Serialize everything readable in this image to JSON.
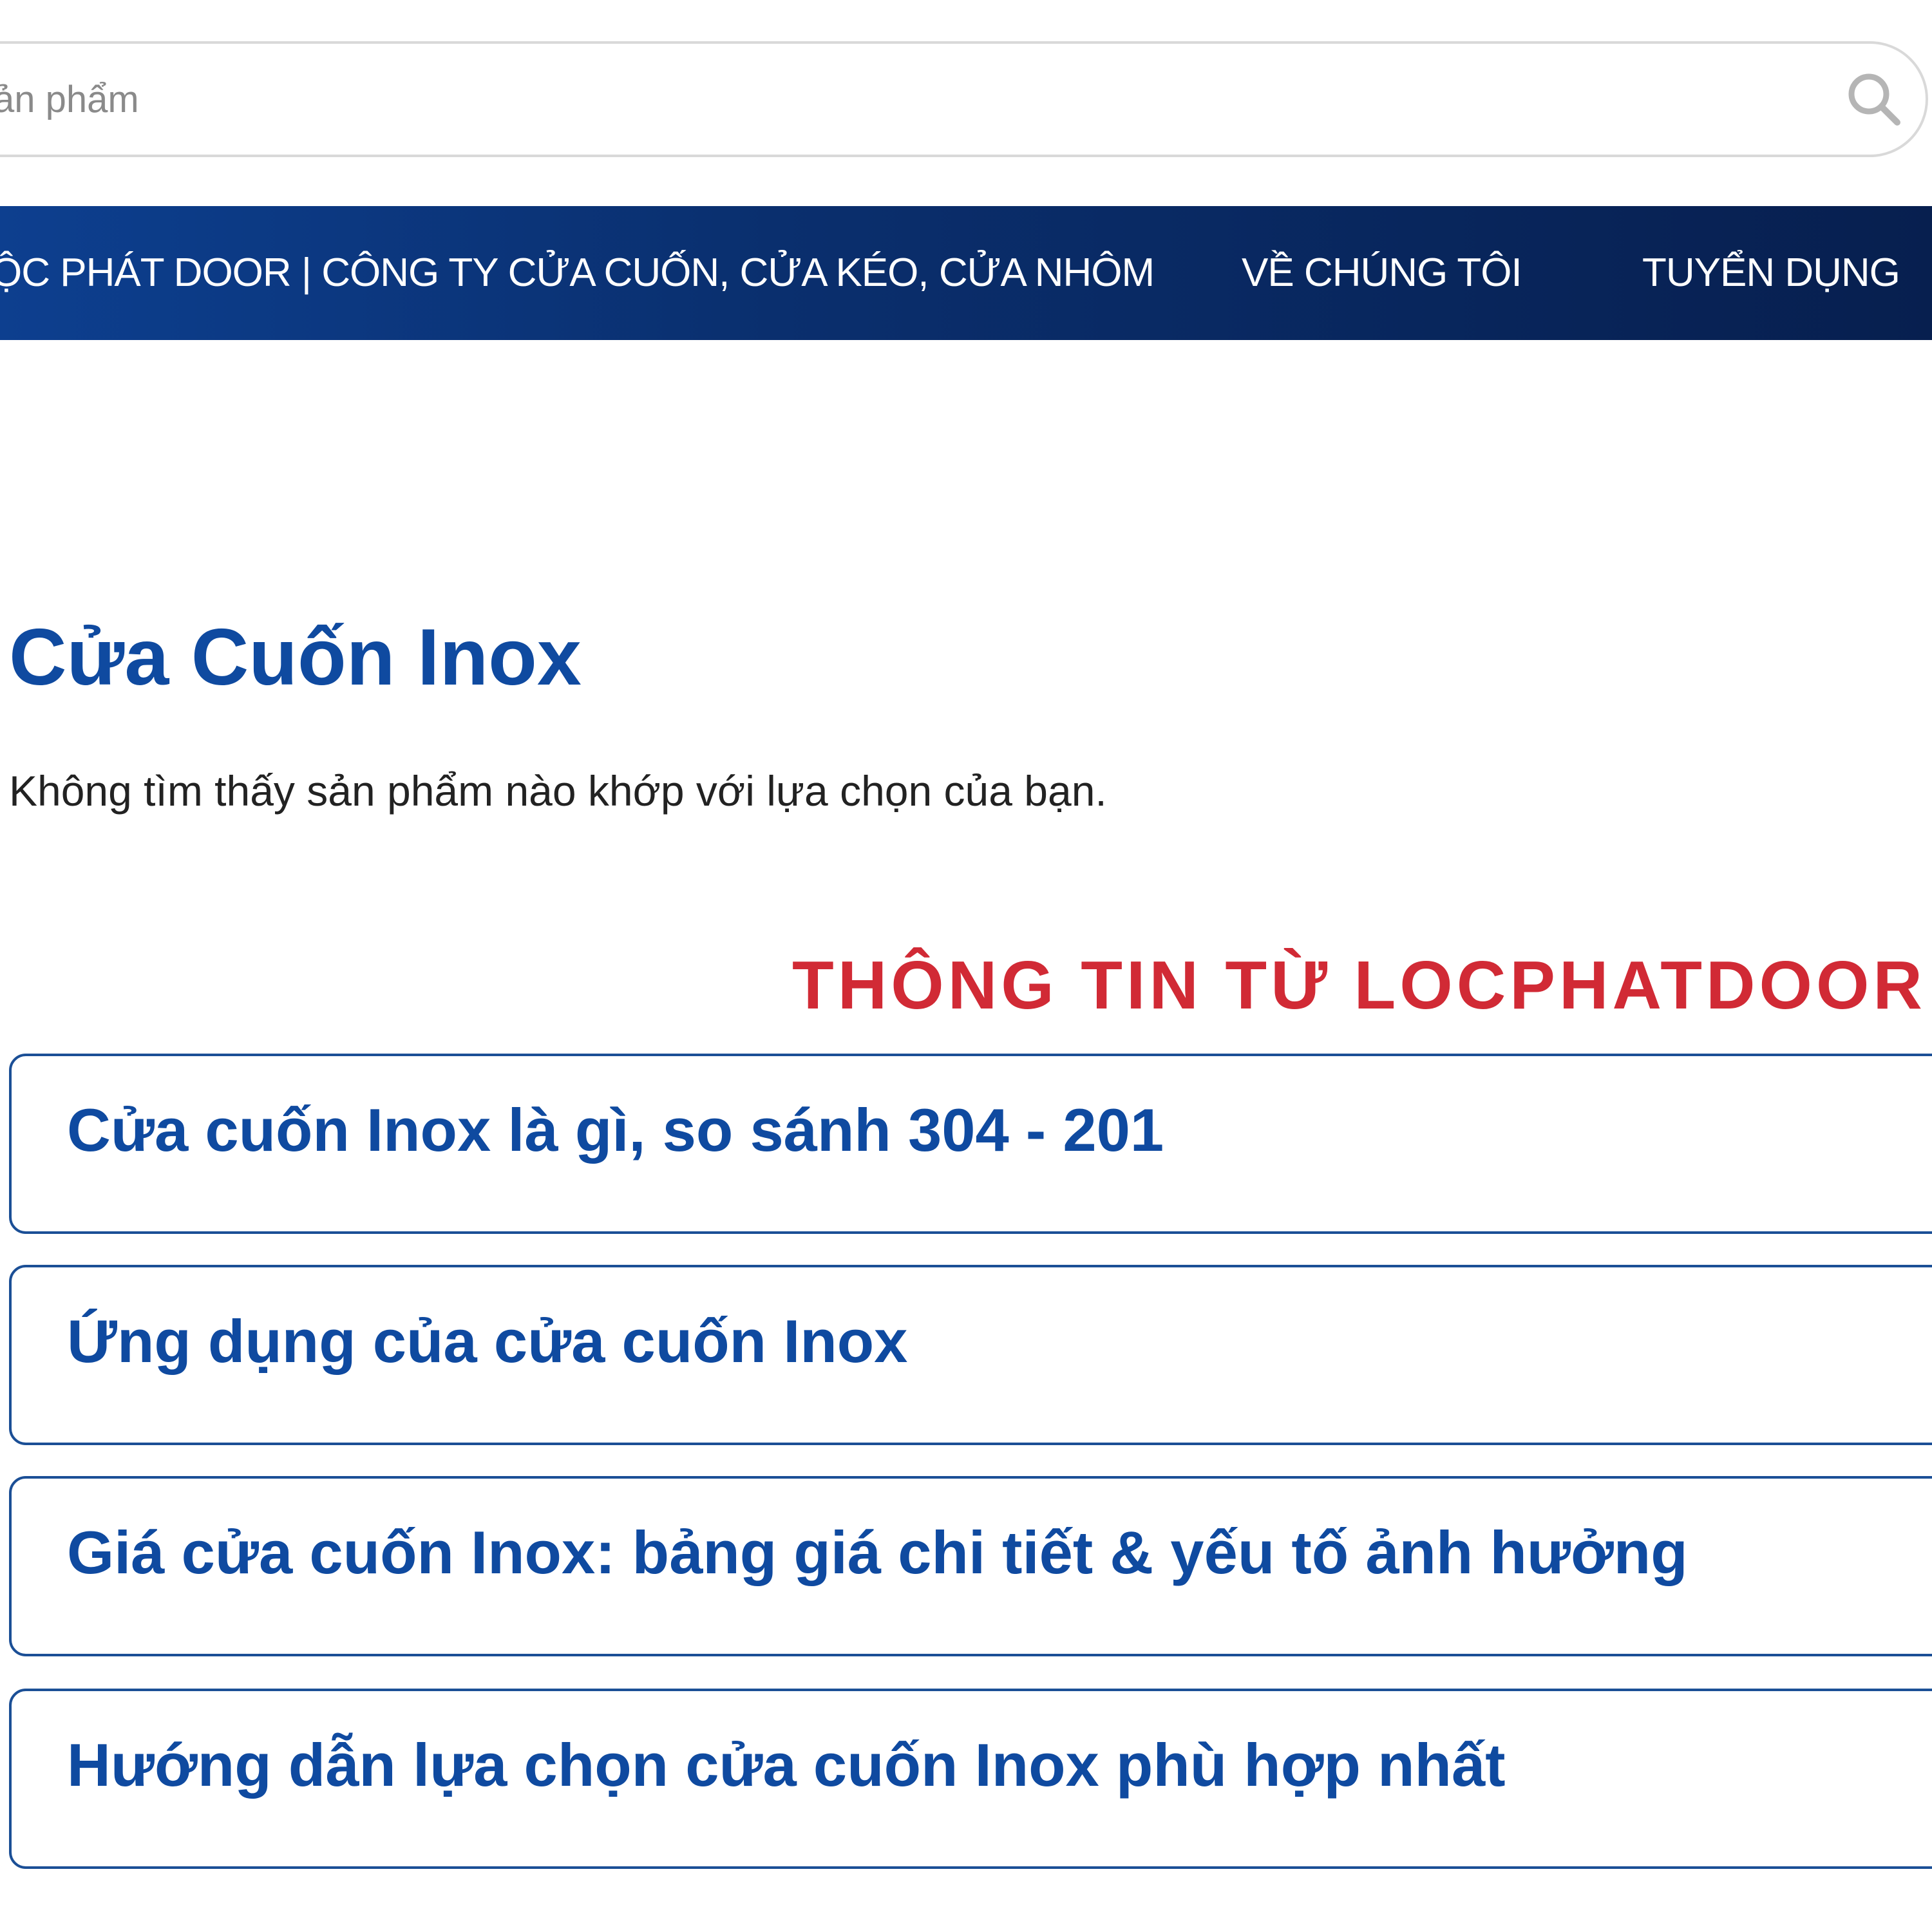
{
  "search": {
    "placeholder": "Tìm kiếm sản phẩm",
    "visible_text": "ản phẩm"
  },
  "nav": {
    "home_label": "LỘC PHÁT DOOR | CÔNG TY CỬA CUỐN, CỬA KÉO, CỬA NHÔM",
    "home_visible": "ỘC PHÁT DOOR | CÔNG TY CỬA CUỐN, CỬA KÉO, CỬA NHÔM",
    "about_label": "VỀ CHÚNG TÔI",
    "jobs_label": "TUYỂN DỤNG"
  },
  "main": {
    "title": "Cửa Cuốn Inox",
    "empty_message": "Không tìm thấy sản phẩm nào khớp với lựa chọn của bạn.",
    "info_heading": "THÔNG TIN TỪ LOCPHATDOOR",
    "accordion": [
      {
        "title": "Cửa cuốn Inox là gì, so sánh 304 - 201"
      },
      {
        "title": "Ứng dụng của cửa cuốn Inox"
      },
      {
        "title": "Giá cửa cuốn Inox: bảng giá chi tiết & yếu tố ảnh hưởng"
      },
      {
        "title": "Hướng dẫn lựa chọn cửa cuốn Inox phù hợp nhất"
      }
    ]
  },
  "colors": {
    "nav_bg": "#0a2f6e",
    "title_blue": "#0f4aa0",
    "heading_red": "#d12a35",
    "border_blue": "#1b4f96"
  }
}
